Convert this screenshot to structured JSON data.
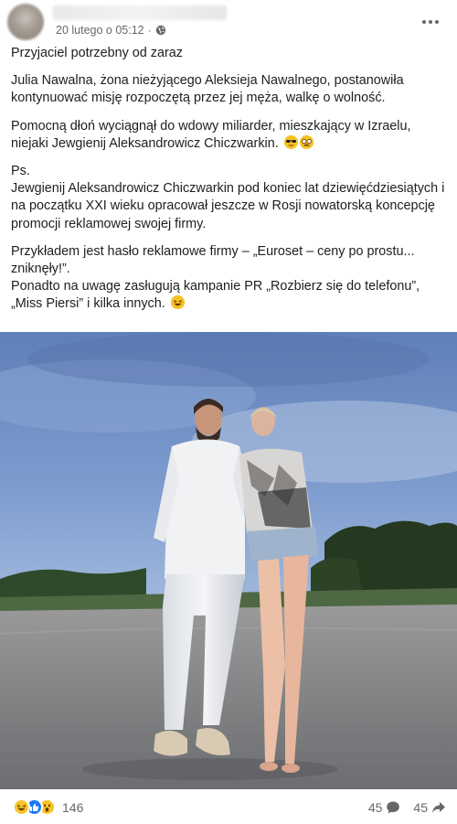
{
  "post": {
    "timestamp": "20 lutego o 05:12",
    "separator": "·",
    "privacy_icon": "globe-icon",
    "more_icon": "more-horizontal-icon",
    "paragraphs": [
      "Przyjaciel potrzebny od zaraz",
      "Julia Nawalna, żona nieżyjącego Aleksieja Nawalnego, postanowiła kontynuować misję rozpoczętą przez jej męża, walkę o wolność.",
      "Pomocną dłoń wyciągnął do wdowy miliarder, mieszkający w Izraelu, niejaki Jewgienij Aleksandrowicz Chiczwarkin.",
      "Ps.\nJewgienij Aleksandrowicz Chiczwarkin pod koniec lat dziewięćdziesiątych i na początku XXI wieku opracował jeszcze w Rosji nowatorską koncepcję promocji reklamowej swojej firmy.",
      "Przykładem jest hasło reklamowe firmy – „Euroset – ceny po prostu... zniknęły!”.\nPonadto na uwagę zasługują kampanie PR „Rozbierz się do telefonu”, „Miss Piersi” i kilka innych."
    ],
    "emojis": [
      "sunglasses-emoji-icon",
      "disguised-face-emoji-icon",
      "laughing-emoji-icon"
    ]
  },
  "footer": {
    "reaction_icons": [
      "haha-reaction-icon",
      "like-reaction-icon",
      "wow-reaction-icon"
    ],
    "reaction_count": "146",
    "comment_count": "45",
    "share_count": "45"
  },
  "colors": {
    "text": "#1c1e21",
    "secondary": "#65676b",
    "like_blue": "#1877f2",
    "reaction_yellow": "#f7c325",
    "sky": "#6e8fc4"
  }
}
